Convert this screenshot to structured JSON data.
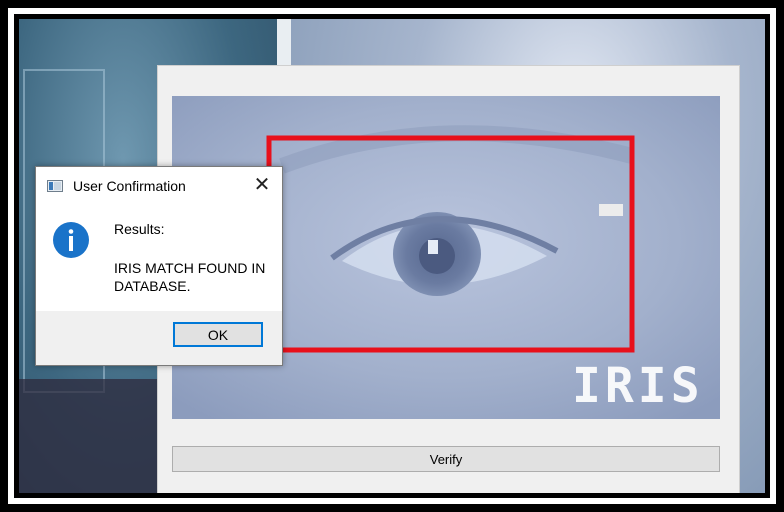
{
  "dialog": {
    "title": "User Confirmation",
    "close_glyph": "✕",
    "icon": "info-icon",
    "heading": "Results:",
    "message": "IRIS MATCH FOUND IN DATABASE.",
    "ok_label": "OK"
  },
  "main": {
    "image_overlay_text": "IRIS",
    "verify_label": "Verify"
  },
  "colors": {
    "detection_box": "#e8101b",
    "info_icon": "#1a73c9",
    "ok_focus": "#0078d7"
  }
}
